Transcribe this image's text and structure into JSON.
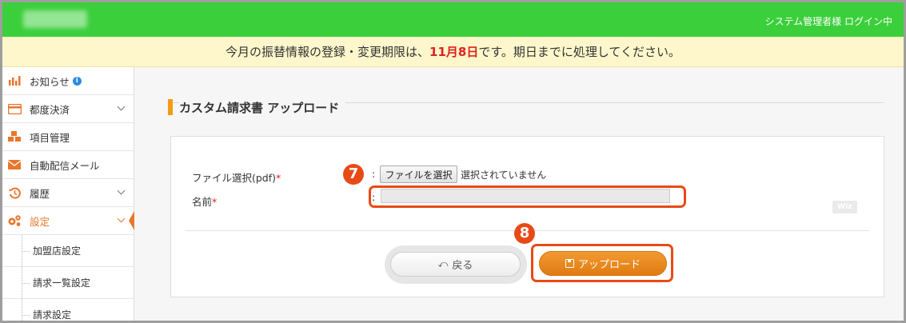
{
  "header": {
    "login_status": "システム管理者様 ログイン中",
    "brand_color": "#3ccf3c"
  },
  "notice": {
    "prefix": "今月の振替情報の登録・変更期限は、",
    "deadline": "11月8日",
    "suffix": "です。期日までに処理してください。"
  },
  "sidebar": {
    "items": [
      {
        "label": "お知らせ",
        "icon": "bar-chart-icon"
      },
      {
        "label": "都度決済",
        "icon": "credit-card-icon"
      },
      {
        "label": "項目管理",
        "icon": "cubes-icon"
      },
      {
        "label": "自動配信メール",
        "icon": "envelope-icon"
      },
      {
        "label": "履歴",
        "icon": "history-icon"
      },
      {
        "label": "設定",
        "icon": "gears-icon"
      }
    ],
    "sub_items": [
      {
        "label": "加盟店設定"
      },
      {
        "label": "請求一覧設定"
      },
      {
        "label": "請求設定"
      }
    ]
  },
  "page": {
    "section_title": "カスタム請求書 アップロード"
  },
  "form": {
    "file_label": "ファイル選択(pdf)",
    "required_mark": "*",
    "colon": ":",
    "file_button": "ファイルを選択",
    "file_status": "選択されていません",
    "name_label": "名前",
    "name_value": "",
    "wiz_badge": "Wiz"
  },
  "steps": {
    "step7": "7",
    "step8": "8"
  },
  "buttons": {
    "back": "戻る",
    "upload": "アップロード"
  },
  "colors": {
    "accent": "#f39c12",
    "highlight": "#e84a17",
    "required": "#e02020"
  }
}
